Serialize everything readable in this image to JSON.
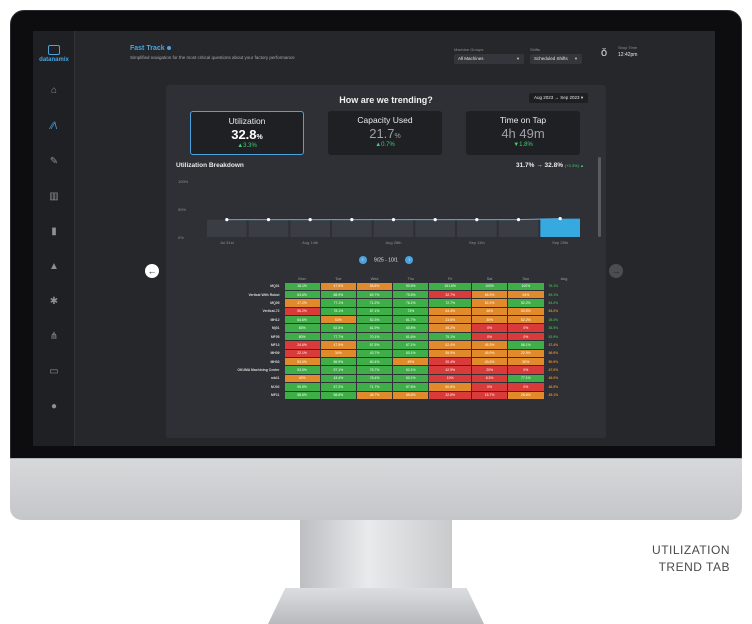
{
  "app": {
    "logo_text": "datanamix"
  },
  "header": {
    "title": "Fast Track",
    "subtitle": "Simplified navigation for the most critical questions about your factory performance",
    "machine_groups": {
      "label": "Machine Groups",
      "value": "All Machines"
    },
    "shifts": {
      "label": "Shifts",
      "value": "Scheduled Shifts"
    },
    "shop_time": {
      "label": "Shop Time",
      "value": "12:42pm"
    }
  },
  "sidebar": {
    "items": [
      "home-icon",
      "trend-icon",
      "wrench-icon",
      "chart-icon",
      "trash-icon",
      "warning-icon",
      "gear-icon",
      "tree-icon",
      "monitor-icon",
      "help-icon"
    ]
  },
  "trend": {
    "title": "How are we trending?",
    "range": "Aug 2023  →  Sep 2023",
    "kpis": [
      {
        "title": "Utilization",
        "value": "32.8",
        "unit": "%",
        "delta": "▲3.3%"
      },
      {
        "title": "Capacity Used",
        "value": "21.7",
        "unit": "%",
        "delta": "▲0.7%"
      },
      {
        "title": "Time on Tap",
        "value": "4h 49m",
        "unit": "",
        "delta": "▼1.8%"
      }
    ]
  },
  "breakdown": {
    "title": "Utilization Breakdown",
    "range_text": "31.7% → 32.8%",
    "range_delta": "(+3.3%) ▲",
    "pager_text": "9/25 - 10/1"
  },
  "chart_data": {
    "type": "bar",
    "categories": [
      "Jul 31st",
      "",
      "Aug 14th",
      "",
      "Aug 28th",
      "",
      "Sep 11th",
      "",
      "Sep 25th"
    ],
    "values": [
      31,
      31,
      31,
      31,
      31,
      31,
      31,
      31,
      32.8
    ],
    "ylim": [
      0,
      100
    ],
    "yticks": [
      "100%",
      "50%",
      "0%"
    ],
    "highlight_index": 8,
    "colors": {
      "bar": "#3b3d44",
      "highlight": "#35a9e0",
      "line": "#5aaee0"
    }
  },
  "heatmap": {
    "days": [
      "Mon",
      "Tue",
      "Wed",
      "Thu",
      "Fri",
      "Sat",
      "Sun"
    ],
    "avg_label": "Aug",
    "rows": [
      {
        "name": "MQ01",
        "cells": [
          [
            "16.1%",
            "g"
          ],
          [
            "47.5%",
            "o"
          ],
          [
            "58.8%",
            "o"
          ],
          [
            "90.5%",
            "g"
          ],
          [
            "151.6%",
            "g"
          ],
          [
            "100%",
            "g"
          ],
          [
            "100%",
            "g"
          ]
        ],
        "avg": "76.1%",
        "avgc": "g"
      },
      {
        "name": "Vertical With Robot",
        "cells": [
          [
            "63.6%",
            "g"
          ],
          [
            "88.9%",
            "g"
          ],
          [
            "69.7%",
            "g"
          ],
          [
            "75.5%",
            "g"
          ],
          [
            "32.7%",
            "r"
          ],
          [
            "65.9%",
            "o"
          ],
          [
            "63%",
            "o"
          ]
        ],
        "avg": "69.1%",
        "avgc": "g"
      },
      {
        "name": "MQ05",
        "cells": [
          [
            "27.2%",
            "o"
          ],
          [
            "77.1%",
            "g"
          ],
          [
            "71.2%",
            "g"
          ],
          [
            "76.1%",
            "g"
          ],
          [
            "72.7%",
            "g"
          ],
          [
            "52.2%",
            "o"
          ],
          [
            "52.2%",
            "g"
          ]
        ],
        "avg": "64.2%",
        "avgc": "g"
      },
      {
        "name": "Vertical-72",
        "cells": [
          [
            "56.2%",
            "r"
          ],
          [
            "78.1%",
            "g"
          ],
          [
            "87.1%",
            "g"
          ],
          [
            "73%",
            "g"
          ],
          [
            "64.4%",
            "o"
          ],
          [
            "46%",
            "o"
          ],
          [
            "63.5%",
            "o"
          ]
        ],
        "avg": "63.2%",
        "avgc": "o"
      },
      {
        "name": "MH12",
        "cells": [
          [
            "64.6%",
            "g"
          ],
          [
            "53%",
            "o"
          ],
          [
            "52.3%",
            "g"
          ],
          [
            "61.7%",
            "g"
          ],
          [
            "23.6%",
            "o"
          ],
          [
            "30%",
            "o"
          ],
          [
            "52.2%",
            "o"
          ]
        ],
        "avg": "28.4%",
        "avgc": "g"
      },
      {
        "name": "Mj01",
        "cells": [
          [
            "83%",
            "g"
          ],
          [
            "52.5%",
            "g"
          ],
          [
            "61.9%",
            "g"
          ],
          [
            "60.8%",
            "g"
          ],
          [
            "45.2%",
            "o"
          ],
          [
            "0%",
            "r"
          ],
          [
            "0%",
            "r"
          ]
        ],
        "avg": "38.5%",
        "avgc": "g"
      },
      {
        "name": "MF05",
        "cells": [
          [
            "80%",
            "g"
          ],
          [
            "77.7%",
            "g"
          ],
          [
            "70.1%",
            "g"
          ],
          [
            "61.6%",
            "g"
          ],
          [
            "75.1%",
            "g"
          ],
          [
            "0%",
            "r"
          ],
          [
            "0%",
            "r"
          ]
        ],
        "avg": "52.9%",
        "avgc": "g"
      },
      {
        "name": "MF13",
        "cells": [
          [
            "24.6%",
            "r"
          ],
          [
            "47.5%",
            "o"
          ],
          [
            "57.5%",
            "g"
          ],
          [
            "67.1%",
            "g"
          ],
          [
            "52.4%",
            "o"
          ],
          [
            "45.3%",
            "o"
          ],
          [
            "58.1%",
            "g"
          ]
        ],
        "avg": "37.4%",
        "avgc": "o"
      },
      {
        "name": "MH09",
        "cells": [
          [
            "22.1%",
            "r"
          ],
          [
            "34%",
            "o"
          ],
          [
            "43.7%",
            "g"
          ],
          [
            "60.1%",
            "g"
          ],
          [
            "55.9%",
            "o"
          ],
          [
            "45.9%",
            "o"
          ],
          [
            "22.9%",
            "o"
          ]
        ],
        "avg": "36.6%",
        "avgc": "o"
      },
      {
        "name": "MH03",
        "cells": [
          [
            "53.0%",
            "o"
          ],
          [
            "56.9%",
            "g"
          ],
          [
            "60.4%",
            "g"
          ],
          [
            "49%",
            "o"
          ],
          [
            "20.4%",
            "r"
          ],
          [
            "43.6%",
            "o"
          ],
          [
            "50%",
            "o"
          ]
        ],
        "avg": "50.9%",
        "avgc": "o"
      },
      {
        "name": "OKUMA Machining Center",
        "cells": [
          [
            "53.5%",
            "g"
          ],
          [
            "57.1%",
            "g"
          ],
          [
            "75.7%",
            "g"
          ],
          [
            "62.1%",
            "g"
          ],
          [
            "42.9%",
            "r"
          ],
          [
            "20%",
            "r"
          ],
          [
            "0%",
            "r"
          ]
        ],
        "avg": "47.0%",
        "avgc": "o"
      },
      {
        "name": "mb11",
        "cells": [
          [
            "40%",
            "o"
          ],
          [
            "43.4%",
            "g"
          ],
          [
            "76.4%",
            "g"
          ],
          [
            "60.1%",
            "g"
          ],
          [
            "10%",
            "r"
          ],
          [
            "8.3%",
            "r"
          ],
          [
            "77.1%",
            "g"
          ]
        ],
        "avg": "46.0%",
        "avgc": "o"
      },
      {
        "name": "MJ02",
        "cells": [
          [
            "55.9%",
            "g"
          ],
          [
            "57.3%",
            "g"
          ],
          [
            "71.7%",
            "g"
          ],
          [
            "57.6%",
            "g"
          ],
          [
            "60.6%",
            "o"
          ],
          [
            "0%",
            "r"
          ],
          [
            "0%",
            "r"
          ]
        ],
        "avg": "46.5%",
        "avgc": "o"
      },
      {
        "name": "MF11",
        "cells": [
          [
            "58.6%",
            "g"
          ],
          [
            "58.8%",
            "g"
          ],
          [
            "48.7%",
            "o"
          ],
          [
            "65.6%",
            "o"
          ],
          [
            "32.8%",
            "r"
          ],
          [
            "15.7%",
            "r"
          ],
          [
            "28.6%",
            "o"
          ]
        ],
        "avg": "45.1%",
        "avgc": "o"
      }
    ]
  },
  "caption": {
    "line1": "UTILIZATION",
    "line2": "TREND TAB"
  },
  "colors": {
    "accent": "#4aa3df",
    "good": "#3fae49",
    "warn": "#e08a2b",
    "bad": "#d93b3b"
  }
}
